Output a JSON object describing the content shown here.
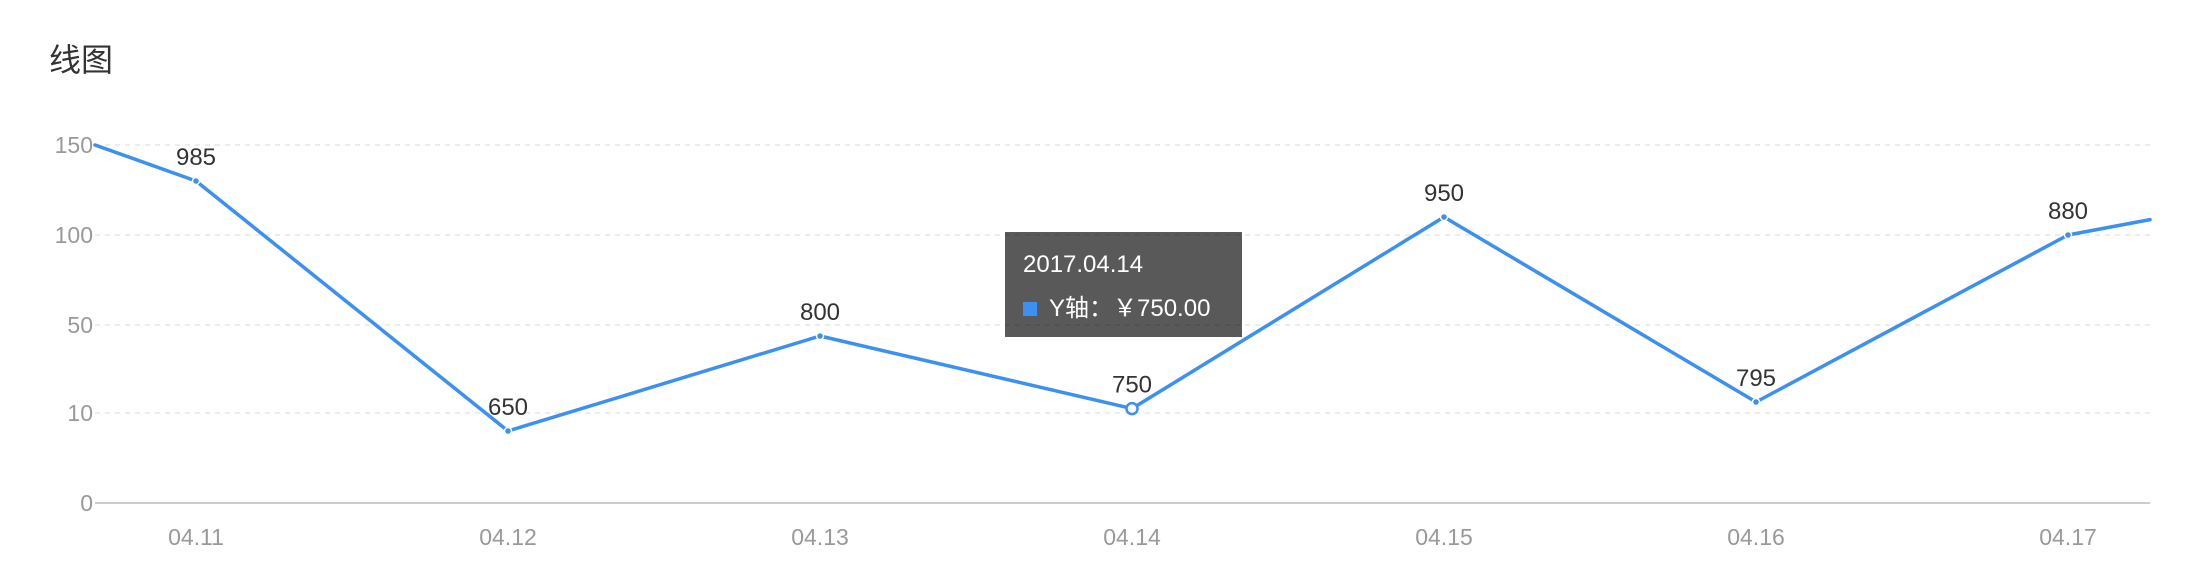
{
  "title": "线图",
  "colors": {
    "line": "#3b90f0",
    "axis_text": "#999999",
    "label_text": "#333333",
    "grid": "#e6e6e6"
  },
  "chart_data": {
    "type": "line",
    "title": "线图",
    "xlabel": "",
    "ylabel": "",
    "categories": [
      "04.11",
      "04.12",
      "04.13",
      "04.14",
      "04.15",
      "04.16",
      "04.17"
    ],
    "y_ticks": [
      "0",
      "10",
      "50",
      "100",
      "150"
    ],
    "series": [
      {
        "values": [
          130,
          8,
          45,
          12,
          110,
          15,
          100
        ],
        "labels": [
          "985",
          "650",
          "800",
          "750",
          "950",
          "795",
          "880"
        ]
      }
    ],
    "grid": true,
    "legend": "none"
  },
  "tooltip": {
    "title": "2017.04.14",
    "series_label": "Y轴：",
    "value_text": "￥750.00",
    "marker_color": "#3b90f0"
  }
}
